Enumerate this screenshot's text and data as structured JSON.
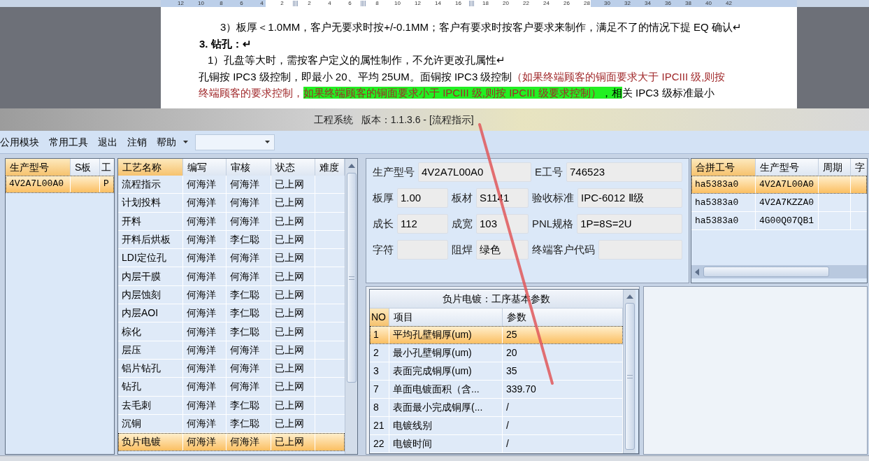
{
  "ruler": {
    "marks": [
      {
        "kind": "number",
        "text": "12"
      },
      {
        "kind": "number",
        "text": "10"
      },
      {
        "kind": "number",
        "text": "8"
      },
      {
        "kind": "number",
        "text": "6"
      },
      {
        "kind": "number",
        "text": "4"
      },
      {
        "kind": "number",
        "text": "2"
      },
      {
        "kind": "stop"
      },
      {
        "kind": "number",
        "text": "2"
      },
      {
        "kind": "number",
        "text": "4"
      },
      {
        "kind": "number",
        "text": "6"
      },
      {
        "kind": "stop"
      },
      {
        "kind": "number",
        "text": "8"
      },
      {
        "kind": "number",
        "text": "10"
      },
      {
        "kind": "number",
        "text": "12"
      },
      {
        "kind": "number",
        "text": "14"
      },
      {
        "kind": "number",
        "text": "16"
      },
      {
        "kind": "stop"
      },
      {
        "kind": "number",
        "text": "18"
      },
      {
        "kind": "number",
        "text": "20"
      },
      {
        "kind": "number",
        "text": "22"
      },
      {
        "kind": "number",
        "text": "24"
      },
      {
        "kind": "number",
        "text": "26"
      },
      {
        "kind": "number",
        "text": "28"
      },
      {
        "kind": "number",
        "text": "30"
      },
      {
        "kind": "number",
        "text": "32"
      },
      {
        "kind": "number",
        "text": "34"
      },
      {
        "kind": "number",
        "text": "36"
      },
      {
        "kind": "number",
        "text": "38"
      },
      {
        "kind": "number",
        "text": "40"
      },
      {
        "kind": "number",
        "text": "42"
      }
    ]
  },
  "document": {
    "blocks": [
      {
        "kind": "item",
        "lines": [
          [
            {
              "kind": "plain",
              "text": "3）板厚＜1.0MM，客户无要求时按+/-0.1MM；客户有要求时按客户要求来制作，满足不了的情况下提 EQ 确认↵"
            }
          ]
        ]
      },
      {
        "kind": "heading",
        "lines": [
          [
            {
              "kind": "plain",
              "text": "3.  钻孔：↵"
            }
          ]
        ]
      },
      {
        "kind": "subitem",
        "lines": [
          [
            {
              "kind": "plain",
              "text": "1）孔盘等大时，需按客户定义的属性制作，不允许更改孔属性↵"
            }
          ]
        ]
      },
      {
        "kind": "body",
        "lines": [
          [
            {
              "kind": "plain",
              "text": "孔铜按 IPC3 级控制，即最小 20、平均 25UM。面铜按 IPC3 级控制"
            },
            {
              "kind": "red",
              "text": "（如果终端顾客的铜面要求大于 IPCIII 级,则按"
            }
          ],
          [
            {
              "kind": "red",
              "text": "终端顾客的要求控制，"
            },
            {
              "kind": "red-highlight",
              "text": "如果终端顾客的铜面要求小于 IPCIII 级,则按 IPCIII 级要求控制）"
            },
            {
              "kind": "highlight",
              "text": "，相"
            },
            {
              "kind": "plain",
              "text": "关 IPC3 级标准最小"
            }
          ]
        ]
      }
    ]
  },
  "window": {
    "title": "工程系统   版本：1.1.3.6 - [流程指示]"
  },
  "menu": {
    "items": [
      "公用模块",
      "常用工具",
      "退出",
      "注销",
      "帮助"
    ]
  },
  "product_list": {
    "columns": [
      {
        "label": "生产型号",
        "selected": true
      },
      {
        "label": "S板",
        "selected": false
      },
      {
        "label": "工",
        "selected": false
      }
    ],
    "rows": [
      {
        "cells": [
          "4V2A7L00A0",
          "",
          "P"
        ],
        "selected": true
      }
    ]
  },
  "process_table": {
    "columns": [
      {
        "label": "工艺名称",
        "selected": true
      },
      {
        "label": "编写",
        "selected": false
      },
      {
        "label": "审核",
        "selected": false
      },
      {
        "label": "状态",
        "selected": false
      },
      {
        "label": "难度",
        "selected": false
      }
    ],
    "rows": [
      {
        "cells": [
          "流程指示",
          "何海洋",
          "何海洋",
          "已上网"
        ],
        "selected": false
      },
      {
        "cells": [
          "计划投料",
          "何海洋",
          "何海洋",
          "已上网"
        ],
        "selected": false
      },
      {
        "cells": [
          "开料",
          "何海洋",
          "何海洋",
          "已上网"
        ],
        "selected": false
      },
      {
        "cells": [
          "开料后烘板",
          "何海洋",
          "李仁聪",
          "已上网"
        ],
        "selected": false
      },
      {
        "cells": [
          "LDI定位孔",
          "何海洋",
          "何海洋",
          "已上网"
        ],
        "selected": false
      },
      {
        "cells": [
          "内层干膜",
          "何海洋",
          "何海洋",
          "已上网"
        ],
        "selected": false
      },
      {
        "cells": [
          "内层蚀刻",
          "何海洋",
          "李仁聪",
          "已上网"
        ],
        "selected": false
      },
      {
        "cells": [
          "内层AOI",
          "何海洋",
          "李仁聪",
          "已上网"
        ],
        "selected": false
      },
      {
        "cells": [
          "棕化",
          "何海洋",
          "李仁聪",
          "已上网"
        ],
        "selected": false
      },
      {
        "cells": [
          "层压",
          "何海洋",
          "何海洋",
          "已上网"
        ],
        "selected": false
      },
      {
        "cells": [
          "铝片钻孔",
          "何海洋",
          "何海洋",
          "已上网"
        ],
        "selected": false
      },
      {
        "cells": [
          "钻孔",
          "何海洋",
          "何海洋",
          "已上网"
        ],
        "selected": false
      },
      {
        "cells": [
          "去毛刺",
          "何海洋",
          "李仁聪",
          "已上网"
        ],
        "selected": false
      },
      {
        "cells": [
          "沉铜",
          "何海洋",
          "李仁聪",
          "已上网"
        ],
        "selected": false
      },
      {
        "cells": [
          "负片电镀",
          "何海洋",
          "何海洋",
          "已上网"
        ],
        "selected": true
      }
    ]
  },
  "job_form": {
    "rows": [
      {
        "kind": "wide",
        "fields": [
          {
            "label": "生产型号",
            "value": "4V2A7L00A0"
          },
          {
            "label": "E工号",
            "value": "746523"
          }
        ]
      },
      {
        "kind": "triple",
        "fields": [
          {
            "label": "板厚",
            "value": "1.00"
          },
          {
            "label": "板材",
            "value": "S1141"
          },
          {
            "label": "验收标准",
            "value": "IPC-6012 Ⅱ级"
          }
        ]
      },
      {
        "kind": "triple",
        "fields": [
          {
            "label": "成长",
            "value": "112"
          },
          {
            "label": "成宽",
            "value": "103"
          },
          {
            "label": "PNL规格",
            "value": "1P=8S=2U"
          }
        ]
      },
      {
        "kind": "triple",
        "fields": [
          {
            "label": "字符"
          },
          {
            "label": "阻焊",
            "value": "绿色"
          },
          {
            "label": "终端客户代码"
          }
        ]
      }
    ]
  },
  "merge_table": {
    "columns": [
      {
        "label": "合拼工号",
        "selected": true
      },
      {
        "label": "生产型号",
        "selected": false
      },
      {
        "label": "周期",
        "selected": false
      },
      {
        "label": "字",
        "selected": false
      }
    ],
    "rows": [
      {
        "cells": [
          "ha5383a0",
          "4V2A7L00A0",
          "",
          ""
        ],
        "selected": true
      },
      {
        "cells": [
          "ha5383a0",
          "4V2A7KZZA0",
          "",
          ""
        ],
        "selected": false
      },
      {
        "cells": [
          "ha5383a0",
          "4G00Q07QB1",
          "",
          ""
        ],
        "selected": false
      }
    ]
  },
  "param_table": {
    "title": "负片电镀：工序基本参数",
    "columns": [
      {
        "label": "NO",
        "selected": true
      },
      {
        "label": "项目",
        "selected": false
      },
      {
        "label": "参数",
        "selected": false
      }
    ],
    "rows": [
      {
        "cells": [
          "1",
          "平均孔壁铜厚(um)",
          "25"
        ],
        "selected": true
      },
      {
        "cells": [
          "2",
          "最小孔壁铜厚(um)",
          "20"
        ],
        "selected": false
      },
      {
        "cells": [
          "3",
          "表面完成铜厚(um)",
          "35"
        ],
        "selected": false
      },
      {
        "cells": [
          "7",
          "单面电镀面积（含...",
          "339.70"
        ],
        "selected": false
      },
      {
        "cells": [
          "8",
          "表面最小完成铜厚(...",
          "/"
        ],
        "selected": false
      },
      {
        "cells": [
          "21",
          "电镀线别",
          "/"
        ],
        "selected": false
      },
      {
        "cells": [
          "22",
          "电镀时间",
          "/"
        ],
        "selected": false
      }
    ]
  }
}
